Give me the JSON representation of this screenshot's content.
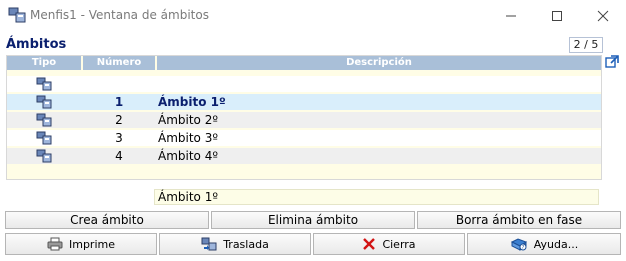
{
  "window": {
    "title": "Menfis1 - Ventana de ámbitos"
  },
  "section": {
    "title": "Ámbitos",
    "page_counter": "2 / 5"
  },
  "grid": {
    "columns": [
      "Tipo",
      "Número",
      "Descripción"
    ],
    "rows": [
      {
        "numero": "",
        "descripcion": ""
      },
      {
        "numero": "1",
        "descripcion": "Ámbito 1º"
      },
      {
        "numero": "2",
        "descripcion": "Ámbito 2º"
      },
      {
        "numero": "3",
        "descripcion": "Ámbito 3º"
      },
      {
        "numero": "4",
        "descripcion": "Ámbito 4º"
      }
    ],
    "selected_index": 1
  },
  "detail": {
    "value": "Ámbito 1º"
  },
  "actions": {
    "create": "Crea ámbito",
    "delete": "Elimina ámbito",
    "clear_phase": "Borra ámbito en fase"
  },
  "footer": {
    "print": "Imprime",
    "move": "Traslada",
    "close": "Cierra",
    "help": "Ayuda..."
  }
}
